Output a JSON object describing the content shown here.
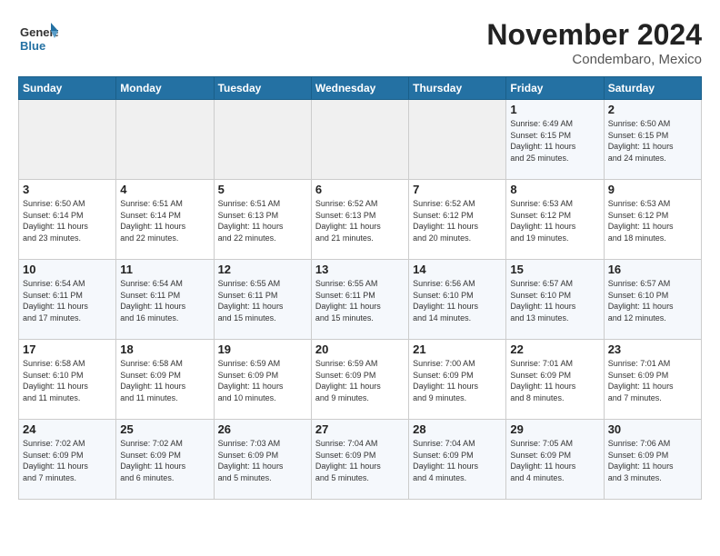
{
  "logo": {
    "general": "General",
    "blue": "Blue"
  },
  "title": "November 2024",
  "location": "Condembaro, Mexico",
  "days_of_week": [
    "Sunday",
    "Monday",
    "Tuesday",
    "Wednesday",
    "Thursday",
    "Friday",
    "Saturday"
  ],
  "weeks": [
    [
      {
        "day": "",
        "info": ""
      },
      {
        "day": "",
        "info": ""
      },
      {
        "day": "",
        "info": ""
      },
      {
        "day": "",
        "info": ""
      },
      {
        "day": "",
        "info": ""
      },
      {
        "day": "1",
        "info": "Sunrise: 6:49 AM\nSunset: 6:15 PM\nDaylight: 11 hours\nand 25 minutes."
      },
      {
        "day": "2",
        "info": "Sunrise: 6:50 AM\nSunset: 6:15 PM\nDaylight: 11 hours\nand 24 minutes."
      }
    ],
    [
      {
        "day": "3",
        "info": "Sunrise: 6:50 AM\nSunset: 6:14 PM\nDaylight: 11 hours\nand 23 minutes."
      },
      {
        "day": "4",
        "info": "Sunrise: 6:51 AM\nSunset: 6:14 PM\nDaylight: 11 hours\nand 22 minutes."
      },
      {
        "day": "5",
        "info": "Sunrise: 6:51 AM\nSunset: 6:13 PM\nDaylight: 11 hours\nand 22 minutes."
      },
      {
        "day": "6",
        "info": "Sunrise: 6:52 AM\nSunset: 6:13 PM\nDaylight: 11 hours\nand 21 minutes."
      },
      {
        "day": "7",
        "info": "Sunrise: 6:52 AM\nSunset: 6:12 PM\nDaylight: 11 hours\nand 20 minutes."
      },
      {
        "day": "8",
        "info": "Sunrise: 6:53 AM\nSunset: 6:12 PM\nDaylight: 11 hours\nand 19 minutes."
      },
      {
        "day": "9",
        "info": "Sunrise: 6:53 AM\nSunset: 6:12 PM\nDaylight: 11 hours\nand 18 minutes."
      }
    ],
    [
      {
        "day": "10",
        "info": "Sunrise: 6:54 AM\nSunset: 6:11 PM\nDaylight: 11 hours\nand 17 minutes."
      },
      {
        "day": "11",
        "info": "Sunrise: 6:54 AM\nSunset: 6:11 PM\nDaylight: 11 hours\nand 16 minutes."
      },
      {
        "day": "12",
        "info": "Sunrise: 6:55 AM\nSunset: 6:11 PM\nDaylight: 11 hours\nand 15 minutes."
      },
      {
        "day": "13",
        "info": "Sunrise: 6:55 AM\nSunset: 6:11 PM\nDaylight: 11 hours\nand 15 minutes."
      },
      {
        "day": "14",
        "info": "Sunrise: 6:56 AM\nSunset: 6:10 PM\nDaylight: 11 hours\nand 14 minutes."
      },
      {
        "day": "15",
        "info": "Sunrise: 6:57 AM\nSunset: 6:10 PM\nDaylight: 11 hours\nand 13 minutes."
      },
      {
        "day": "16",
        "info": "Sunrise: 6:57 AM\nSunset: 6:10 PM\nDaylight: 11 hours\nand 12 minutes."
      }
    ],
    [
      {
        "day": "17",
        "info": "Sunrise: 6:58 AM\nSunset: 6:10 PM\nDaylight: 11 hours\nand 11 minutes."
      },
      {
        "day": "18",
        "info": "Sunrise: 6:58 AM\nSunset: 6:09 PM\nDaylight: 11 hours\nand 11 minutes."
      },
      {
        "day": "19",
        "info": "Sunrise: 6:59 AM\nSunset: 6:09 PM\nDaylight: 11 hours\nand 10 minutes."
      },
      {
        "day": "20",
        "info": "Sunrise: 6:59 AM\nSunset: 6:09 PM\nDaylight: 11 hours\nand 9 minutes."
      },
      {
        "day": "21",
        "info": "Sunrise: 7:00 AM\nSunset: 6:09 PM\nDaylight: 11 hours\nand 9 minutes."
      },
      {
        "day": "22",
        "info": "Sunrise: 7:01 AM\nSunset: 6:09 PM\nDaylight: 11 hours\nand 8 minutes."
      },
      {
        "day": "23",
        "info": "Sunrise: 7:01 AM\nSunset: 6:09 PM\nDaylight: 11 hours\nand 7 minutes."
      }
    ],
    [
      {
        "day": "24",
        "info": "Sunrise: 7:02 AM\nSunset: 6:09 PM\nDaylight: 11 hours\nand 7 minutes."
      },
      {
        "day": "25",
        "info": "Sunrise: 7:02 AM\nSunset: 6:09 PM\nDaylight: 11 hours\nand 6 minutes."
      },
      {
        "day": "26",
        "info": "Sunrise: 7:03 AM\nSunset: 6:09 PM\nDaylight: 11 hours\nand 5 minutes."
      },
      {
        "day": "27",
        "info": "Sunrise: 7:04 AM\nSunset: 6:09 PM\nDaylight: 11 hours\nand 5 minutes."
      },
      {
        "day": "28",
        "info": "Sunrise: 7:04 AM\nSunset: 6:09 PM\nDaylight: 11 hours\nand 4 minutes."
      },
      {
        "day": "29",
        "info": "Sunrise: 7:05 AM\nSunset: 6:09 PM\nDaylight: 11 hours\nand 4 minutes."
      },
      {
        "day": "30",
        "info": "Sunrise: 7:06 AM\nSunset: 6:09 PM\nDaylight: 11 hours\nand 3 minutes."
      }
    ]
  ]
}
